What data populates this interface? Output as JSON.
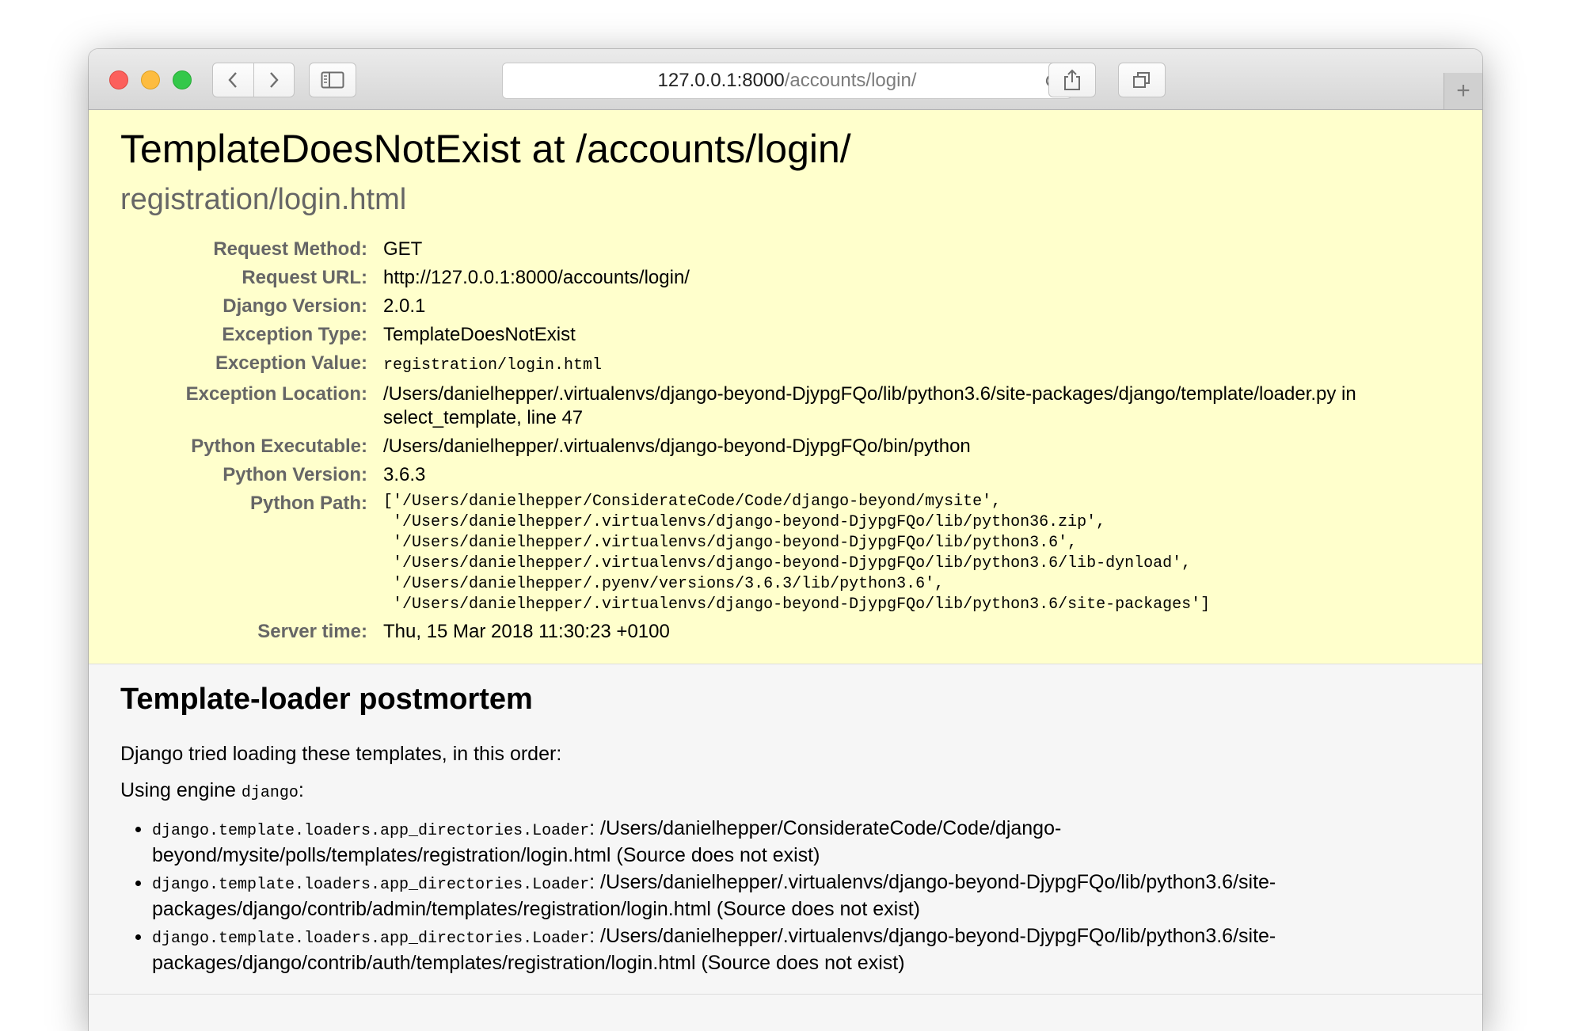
{
  "browser": {
    "url_host": "127.0.0.1:8000",
    "url_path": "/accounts/login/",
    "new_tab_label": "+"
  },
  "error": {
    "title": "TemplateDoesNotExist at /accounts/login/",
    "subtitle": "registration/login.html",
    "rows": {
      "request_method": {
        "label": "Request Method:",
        "value": "GET"
      },
      "request_url": {
        "label": "Request URL:",
        "value": "http://127.0.0.1:8000/accounts/login/"
      },
      "django_version": {
        "label": "Django Version:",
        "value": "2.0.1"
      },
      "exception_type": {
        "label": "Exception Type:",
        "value": "TemplateDoesNotExist"
      },
      "exception_value": {
        "label": "Exception Value:",
        "value": "registration/login.html"
      },
      "exception_location": {
        "label": "Exception Location:",
        "value": "/Users/danielhepper/.virtualenvs/django-beyond-DjypgFQo/lib/python3.6/site-packages/django/template/loader.py in select_template, line 47"
      },
      "python_executable": {
        "label": "Python Executable:",
        "value": "/Users/danielhepper/.virtualenvs/django-beyond-DjypgFQo/bin/python"
      },
      "python_version": {
        "label": "Python Version:",
        "value": "3.6.3"
      },
      "python_path": {
        "label": "Python Path:",
        "value": "['/Users/danielhepper/ConsiderateCode/Code/django-beyond/mysite',\n '/Users/danielhepper/.virtualenvs/django-beyond-DjypgFQo/lib/python36.zip',\n '/Users/danielhepper/.virtualenvs/django-beyond-DjypgFQo/lib/python3.6',\n '/Users/danielhepper/.virtualenvs/django-beyond-DjypgFQo/lib/python3.6/lib-dynload',\n '/Users/danielhepper/.pyenv/versions/3.6.3/lib/python3.6',\n '/Users/danielhepper/.virtualenvs/django-beyond-DjypgFQo/lib/python3.6/site-packages']"
      },
      "server_time": {
        "label": "Server time:",
        "value": "Thu, 15 Mar 2018 11:30:23 +0100"
      }
    }
  },
  "postmortem": {
    "heading": "Template-loader postmortem",
    "intro": "Django tried loading these templates, in this order:",
    "engine_prefix": "Using engine ",
    "engine_name": "django",
    "engine_suffix": ":",
    "items": [
      {
        "loader": "django.template.loaders.app_directories.Loader",
        "sep": ": ",
        "path": "/Users/danielhepper/ConsiderateCode/Code/django-beyond/mysite/polls/templates/registration/login.html (Source does not exist)"
      },
      {
        "loader": "django.template.loaders.app_directories.Loader",
        "sep": ": ",
        "path": "/Users/danielhepper/.virtualenvs/django-beyond-DjypgFQo/lib/python3.6/site-packages/django/contrib/admin/templates/registration/login.html (Source does not exist)"
      },
      {
        "loader": "django.template.loaders.app_directories.Loader",
        "sep": ": ",
        "path": "/Users/danielhepper/.virtualenvs/django-beyond-DjypgFQo/lib/python3.6/site-packages/django/contrib/auth/templates/registration/login.html (Source does not exist)"
      }
    ]
  }
}
